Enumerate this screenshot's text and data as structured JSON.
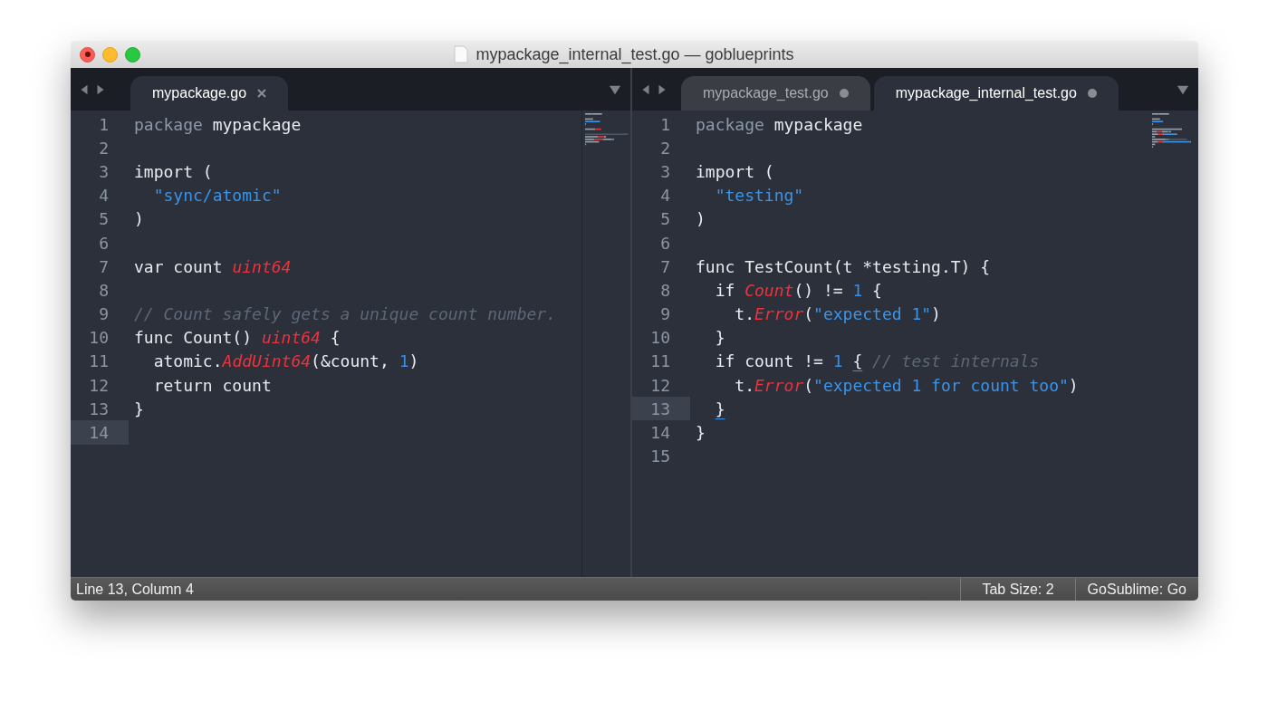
{
  "window": {
    "title": "mypackage_internal_test.go — goblueprints"
  },
  "panes": [
    {
      "tabs": [
        {
          "label": "mypackage.go",
          "selected": true,
          "modified": false
        }
      ],
      "lines": [
        {
          "n": "1",
          "current": false,
          "tokens": [
            {
              "kind": "kw",
              "t": "package"
            },
            {
              "kind": "plain",
              "t": " mypackage"
            }
          ]
        },
        {
          "n": "2",
          "current": false
        },
        {
          "n": "3",
          "current": false,
          "tokens": [
            {
              "kind": "plain",
              "t": "import ("
            }
          ]
        },
        {
          "n": "4",
          "current": false,
          "tokens": [
            {
              "kind": "str",
              "t": "  \"sync/atomic\""
            }
          ]
        },
        {
          "n": "5",
          "current": false,
          "tokens": [
            {
              "kind": "plain",
              "t": ")"
            }
          ]
        },
        {
          "n": "6",
          "current": false
        },
        {
          "n": "7",
          "current": false,
          "tokens": [
            {
              "kind": "plain",
              "t": "var count "
            },
            {
              "kind": "type",
              "t": "uint64"
            }
          ]
        },
        {
          "n": "8",
          "current": false
        },
        {
          "n": "9",
          "current": false,
          "tokens": [
            {
              "kind": "comment",
              "t": "// Count safely gets a unique count number."
            }
          ]
        },
        {
          "n": "10",
          "current": false,
          "tokens": [
            {
              "kind": "plain",
              "t": "func Count() "
            },
            {
              "kind": "type",
              "t": "uint64"
            },
            {
              "kind": "plain",
              "t": " {"
            }
          ]
        },
        {
          "n": "11",
          "current": false,
          "tokens": [
            {
              "kind": "plain",
              "t": "  atomic."
            },
            {
              "kind": "call",
              "t": "AddUint64"
            },
            {
              "kind": "plain",
              "t": "(&count, "
            },
            {
              "kind": "num",
              "t": "1"
            },
            {
              "kind": "plain",
              "t": ")"
            }
          ]
        },
        {
          "n": "12",
          "current": false,
          "tokens": [
            {
              "kind": "plain",
              "t": "  return count"
            }
          ]
        },
        {
          "n": "13",
          "current": false,
          "tokens": [
            {
              "kind": "plain",
              "t": "}"
            }
          ]
        },
        {
          "n": "14",
          "current": true
        }
      ]
    },
    {
      "tabs": [
        {
          "label": "mypackage_test.go",
          "selected": false,
          "modified": true
        },
        {
          "label": "mypackage_internal_test.go",
          "selected": true,
          "modified": true
        }
      ],
      "lines": [
        {
          "n": "1",
          "current": false,
          "tokens": [
            {
              "kind": "kw",
              "t": "package"
            },
            {
              "kind": "plain",
              "t": " mypackage"
            }
          ]
        },
        {
          "n": "2",
          "current": false
        },
        {
          "n": "3",
          "current": false,
          "tokens": [
            {
              "kind": "plain",
              "t": "import ("
            }
          ]
        },
        {
          "n": "4",
          "current": false,
          "tokens": [
            {
              "kind": "str",
              "t": "  \"testing\""
            }
          ]
        },
        {
          "n": "5",
          "current": false,
          "tokens": [
            {
              "kind": "plain",
              "t": ")"
            }
          ]
        },
        {
          "n": "6",
          "current": false
        },
        {
          "n": "7",
          "current": false,
          "tokens": [
            {
              "kind": "plain",
              "t": "func TestCount(t *testing.T) {"
            }
          ]
        },
        {
          "n": "8",
          "current": false,
          "tokens": [
            {
              "kind": "plain",
              "t": "  if "
            },
            {
              "kind": "call",
              "t": "Count"
            },
            {
              "kind": "plain",
              "t": "() != "
            },
            {
              "kind": "num",
              "t": "1"
            },
            {
              "kind": "plain",
              "t": " {"
            }
          ]
        },
        {
          "n": "9",
          "current": false,
          "tokens": [
            {
              "kind": "plain",
              "t": "    t."
            },
            {
              "kind": "call",
              "t": "Error"
            },
            {
              "kind": "plain",
              "t": "("
            },
            {
              "kind": "str",
              "t": "\"expected 1\""
            },
            {
              "kind": "plain",
              "t": ")"
            }
          ]
        },
        {
          "n": "10",
          "current": false,
          "tokens": [
            {
              "kind": "plain",
              "t": "  }"
            }
          ]
        },
        {
          "n": "11",
          "current": false,
          "tokens": [
            {
              "kind": "plain",
              "t": "  if count != "
            },
            {
              "kind": "num",
              "t": "1 "
            },
            {
              "kind": "match",
              "t": "{"
            },
            {
              "kind": "comment",
              "t": " // test internals"
            }
          ]
        },
        {
          "n": "12",
          "current": false,
          "tokens": [
            {
              "kind": "plain",
              "t": "    t."
            },
            {
              "kind": "call",
              "t": "Error"
            },
            {
              "kind": "plain",
              "t": "("
            },
            {
              "kind": "str",
              "t": "\"expected 1 for count too\""
            },
            {
              "kind": "plain",
              "t": ")"
            }
          ]
        },
        {
          "n": "13",
          "current": true,
          "tokens": [
            {
              "kind": "match",
              "t": "  }"
            }
          ]
        },
        {
          "n": "14",
          "current": false,
          "tokens": [
            {
              "kind": "plain",
              "t": "}"
            }
          ]
        },
        {
          "n": "15",
          "current": false
        }
      ]
    }
  ],
  "status_bar": {
    "position": "Line 13, Column 4",
    "tab_size": "Tab Size: 2",
    "syntax": "GoSublime: Go"
  }
}
